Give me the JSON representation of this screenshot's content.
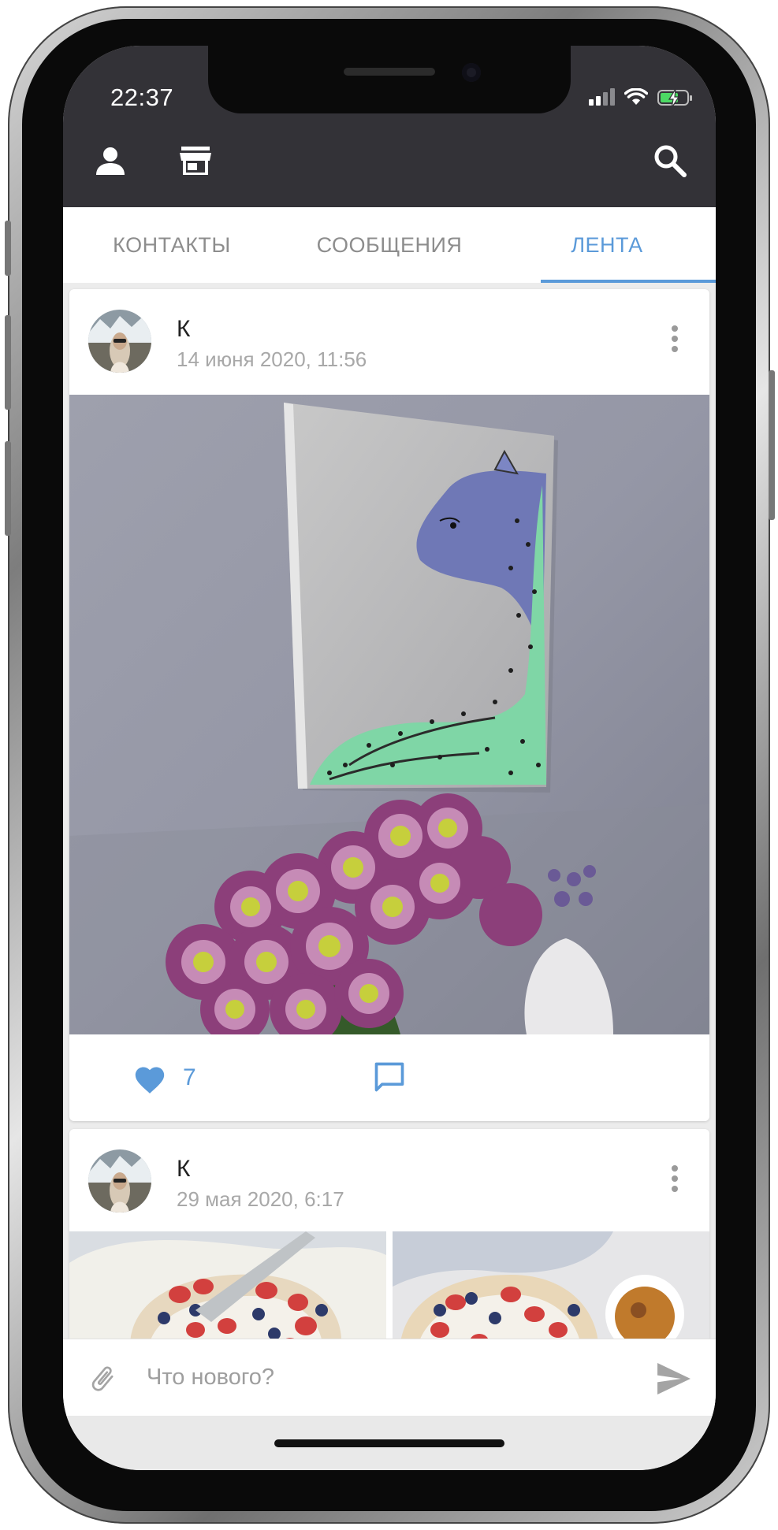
{
  "status_bar": {
    "time": "22:37"
  },
  "toolbar": {
    "icons": [
      "person-icon",
      "store-icon",
      "search-icon"
    ]
  },
  "tabs": [
    {
      "label": "КОНТАКТЫ",
      "active": false
    },
    {
      "label": "СООБЩЕНИЯ",
      "active": false
    },
    {
      "label": "ЛЕНТА",
      "active": true
    }
  ],
  "posts": [
    {
      "author": "К",
      "date": "14 июня 2020, 11:56",
      "likes": "7",
      "liked": true
    },
    {
      "author": "К",
      "date": "29 мая 2020, 6:17"
    }
  ],
  "composer": {
    "placeholder": "Что нового?"
  },
  "colors": {
    "accent": "#5b9ad9",
    "topbar": "#333237",
    "background": "#ececec"
  }
}
